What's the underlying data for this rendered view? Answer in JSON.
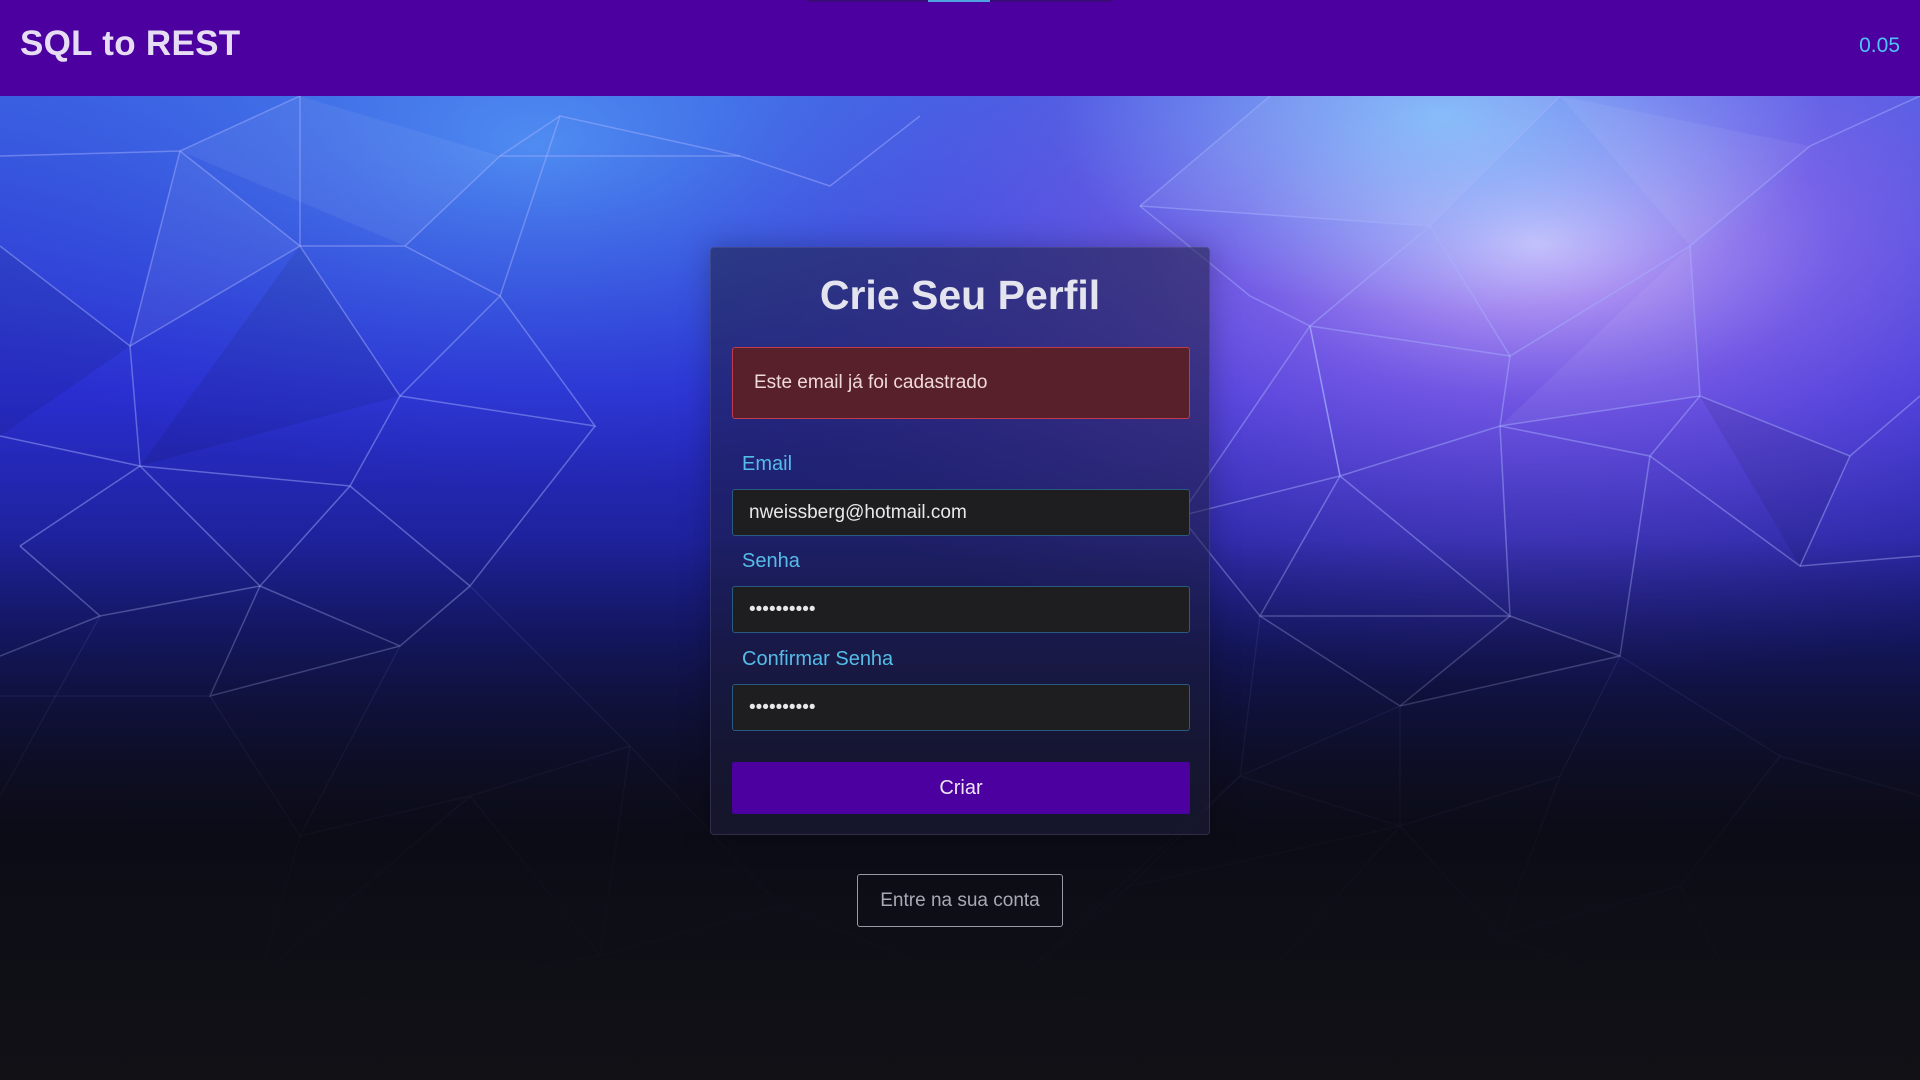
{
  "navbar": {
    "brand": "SQL to REST",
    "version": "0.05"
  },
  "form": {
    "title": "Crie Seu Perfil",
    "error_message": "Este email já foi cadastrado",
    "email_label": "Email",
    "email_value": "nweissberg@hotmail.com",
    "password_label": "Senha",
    "password_value": "••••••••••",
    "confirm_label": "Confirmar Senha",
    "confirm_value": "••••••••••",
    "submit_label": "Criar"
  },
  "login_link": "Entre na sua conta",
  "colors": {
    "navbar": "#4c00a0",
    "accent_label": "#55bce8",
    "version": "#4fc3f7",
    "alert_bg": "#58202a",
    "alert_border": "#c23b4a",
    "button": "#4c00a0"
  }
}
